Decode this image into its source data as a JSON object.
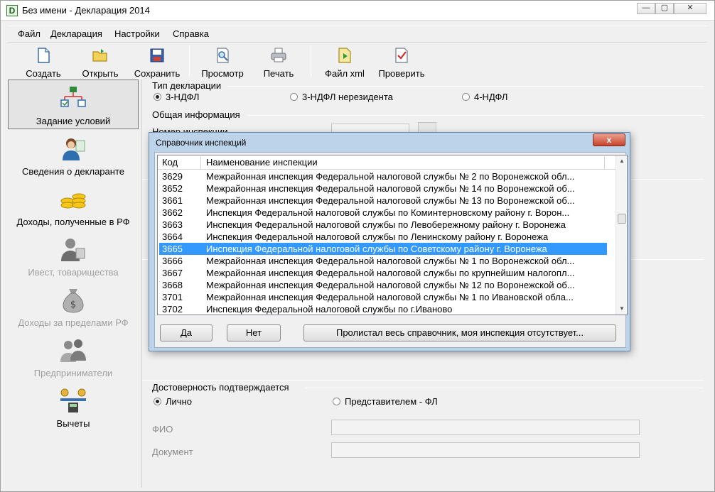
{
  "window": {
    "app_icon": "D",
    "title": "Без имени - Декларация 2014",
    "controls": {
      "minimize": "—",
      "maximize": "▢",
      "close": "✕"
    }
  },
  "menu": [
    "Файл",
    "Декларация",
    "Настройки",
    "Справка"
  ],
  "toolbar": [
    {
      "label": "Создать",
      "icon": "new-document-icon"
    },
    {
      "label": "Открыть",
      "icon": "open-folder-icon"
    },
    {
      "label": "Сохранить",
      "icon": "save-disk-icon"
    },
    {
      "label": "Просмотр",
      "icon": "preview-icon"
    },
    {
      "label": "Печать",
      "icon": "printer-icon"
    },
    {
      "label": "Файл xml",
      "icon": "xml-file-icon"
    },
    {
      "label": "Проверить",
      "icon": "check-document-icon"
    }
  ],
  "sidebar": [
    {
      "label": "Задание условий",
      "icon": "conditions-tree-icon",
      "active": true,
      "enabled": true
    },
    {
      "label": "Сведения о декларанте",
      "icon": "person-icon",
      "active": false,
      "enabled": true
    },
    {
      "label": "Доходы, полученные в РФ",
      "icon": "coins-icon",
      "active": false,
      "enabled": true
    },
    {
      "label": "Ивест, товарищества",
      "icon": "investor-icon",
      "active": false,
      "enabled": false
    },
    {
      "label": "Доходы за пределами РФ",
      "icon": "money-bag-icon",
      "active": false,
      "enabled": false
    },
    {
      "label": "Предприниматели",
      "icon": "entrepreneurs-icon",
      "active": false,
      "enabled": false
    },
    {
      "label": "Вычеты",
      "icon": "deductions-scales-icon",
      "active": false,
      "enabled": true
    }
  ],
  "form": {
    "type_group": "Тип декларации",
    "type_options": [
      {
        "label": "3-НДФЛ",
        "selected": true
      },
      {
        "label": "3-НДФЛ нерезидента",
        "selected": false
      },
      {
        "label": "4-НДФЛ",
        "selected": false
      }
    ],
    "info_group": "Общая информация",
    "inspection_label": "Номер инспекции",
    "confirm_group": "Достоверность подтверждается",
    "confirm_options": [
      {
        "label": "Лично",
        "selected": true
      },
      {
        "label": "Представителем - ФЛ",
        "selected": false
      }
    ],
    "fio_label": "ФИО",
    "doc_label": "Документ"
  },
  "dialog": {
    "title": "Справочник инспекций",
    "close": "x",
    "columns": [
      "Код",
      "Наименование инспекции"
    ],
    "rows": [
      {
        "code": "3629",
        "name": "Межрайонная инспекция Федеральной налоговой службы № 2 по Воронежской обл..."
      },
      {
        "code": "3652",
        "name": "Межрайонная инспекция Федеральной налоговой службы № 14 по Воронежской об..."
      },
      {
        "code": "3661",
        "name": "Межрайонная инспекция Федеральной налоговой службы № 13 по Воронежской об..."
      },
      {
        "code": "3662",
        "name": "Инспекция Федеральной налоговой службы по Коминтерновскому району г. Ворон..."
      },
      {
        "code": "3663",
        "name": "Инспекция Федеральной налоговой службы по Левобережному району г. Воронежа"
      },
      {
        "code": "3664",
        "name": "Инспекция Федеральной налоговой службы по Ленинскому району г. Воронежа"
      },
      {
        "code": "3665",
        "name": "Инспекция Федеральной налоговой службы по Советскому району г. Воронежа",
        "selected": true
      },
      {
        "code": "3666",
        "name": "Межрайонная инспекция Федеральной налоговой службы № 1 по Воронежской обл..."
      },
      {
        "code": "3667",
        "name": "Межрайонная инспекция Федеральной налоговой службы по крупнейшим налогопл..."
      },
      {
        "code": "3668",
        "name": "Межрайонная инспекция Федеральной налоговой службы № 12 по Воронежской об..."
      },
      {
        "code": "3701",
        "name": "Межрайонная инспекция Федеральной налоговой службы № 1 по Ивановской обла..."
      },
      {
        "code": "3702",
        "name": "Инспекция Федеральной налоговой службы по г.Иваново"
      }
    ],
    "buttons": {
      "yes": "Да",
      "no": "Нет",
      "not_found": "Пролистал весь справочник, моя инспекция отсутствует..."
    }
  }
}
